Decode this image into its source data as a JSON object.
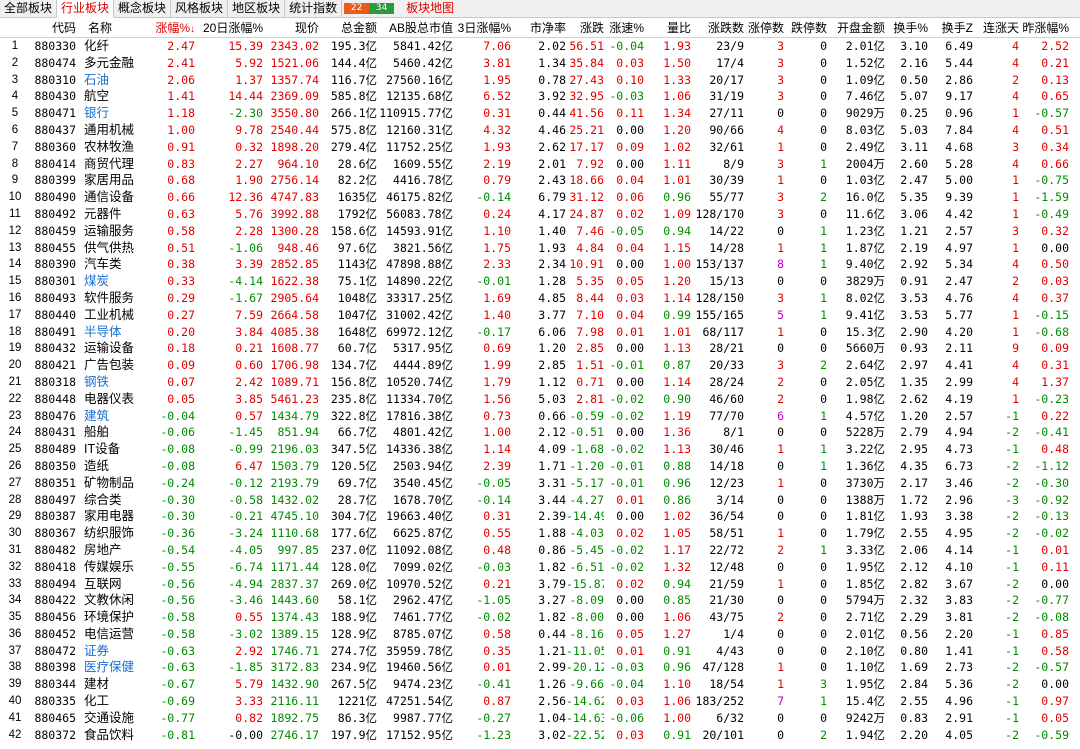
{
  "tabs": [
    "全部板块",
    "行业板块",
    "概念板块",
    "风格板块",
    "地区板块",
    "统计指数"
  ],
  "active_tab": 1,
  "breadth": {
    "up": "22",
    "down": "34"
  },
  "map_tab": "板块地图",
  "columns": [
    "",
    "代码",
    "名称",
    "涨幅%",
    "20日涨幅%",
    "现价",
    "总金额",
    "AB股总市值",
    "3日涨幅%",
    "市净率",
    "涨跌",
    "涨速%",
    "量比",
    "涨跌数",
    "涨停数",
    "跌停数",
    "开盘金额",
    "换手%",
    "换手Z",
    "连涨天",
    "昨涨幅%"
  ],
  "sort_column": "涨幅%",
  "sort_arrow": "↓",
  "colors": {
    "up": "#e00000",
    "down": "#008a00",
    "link": "#1a6fd0",
    "magenta": "#c000c0"
  },
  "rows": [
    [
      "1",
      "880330",
      "化纤",
      "2.47",
      "15.39",
      "2343.02",
      "195.3亿",
      "5841.42亿",
      "7.06",
      "2.02",
      "56.51",
      "-0.04",
      "1.93",
      "23/9",
      "3",
      "0",
      "2.01亿",
      "3.10",
      "6.49",
      "4",
      "2.52"
    ],
    [
      "2",
      "880474",
      "多元金融",
      "2.41",
      "5.92",
      "1521.06",
      "144.4亿",
      "5460.42亿",
      "3.81",
      "1.34",
      "35.84",
      "0.03",
      "1.50",
      "17/4",
      "3",
      "0",
      "1.52亿",
      "2.16",
      "5.44",
      "4",
      "0.21"
    ],
    [
      "3",
      "880310",
      "石油",
      "2.06",
      "1.37",
      "1357.74",
      "116.7亿",
      "27560.16亿",
      "1.95",
      "0.78",
      "27.43",
      "0.10",
      "1.33",
      "20/17",
      "3",
      "0",
      "1.09亿",
      "0.50",
      "2.86",
      "2",
      "0.13"
    ],
    [
      "4",
      "880430",
      "航空",
      "1.41",
      "14.44",
      "2369.09",
      "585.8亿",
      "12135.68亿",
      "6.52",
      "3.92",
      "32.95",
      "-0.03",
      "1.06",
      "31/19",
      "3",
      "0",
      "7.46亿",
      "5.07",
      "9.17",
      "4",
      "0.65"
    ],
    [
      "5",
      "880471",
      "银行",
      "1.18",
      "-2.30",
      "3550.80",
      "266.1亿",
      "110915.77亿",
      "0.31",
      "0.44",
      "41.56",
      "0.11",
      "1.34",
      "27/11",
      "0",
      "0",
      "9029万",
      "0.25",
      "0.96",
      "1",
      "-0.57"
    ],
    [
      "6",
      "880437",
      "通用机械",
      "1.00",
      "9.78",
      "2540.44",
      "575.8亿",
      "12160.31亿",
      "4.32",
      "4.46",
      "25.21",
      "0.00",
      "1.20",
      "90/66",
      "4",
      "0",
      "8.03亿",
      "5.03",
      "7.84",
      "4",
      "0.51"
    ],
    [
      "7",
      "880360",
      "农林牧渔",
      "0.91",
      "0.32",
      "1898.20",
      "279.4亿",
      "11752.25亿",
      "1.93",
      "2.62",
      "17.17",
      "0.09",
      "1.02",
      "32/61",
      "1",
      "0",
      "2.49亿",
      "3.11",
      "4.68",
      "3",
      "0.34"
    ],
    [
      "8",
      "880414",
      "商贸代理",
      "0.83",
      "2.27",
      "964.10",
      "28.6亿",
      "1609.55亿",
      "2.19",
      "2.01",
      "7.92",
      "0.00",
      "1.11",
      "8/9",
      "3",
      "1",
      "2004万",
      "2.60",
      "5.28",
      "4",
      "0.66"
    ],
    [
      "9",
      "880399",
      "家居用品",
      "0.68",
      "1.90",
      "2756.14",
      "82.2亿",
      "4416.78亿",
      "0.79",
      "2.43",
      "18.66",
      "0.04",
      "1.01",
      "30/39",
      "1",
      "0",
      "1.03亿",
      "2.47",
      "5.00",
      "1",
      "-0.75"
    ],
    [
      "10",
      "880490",
      "通信设备",
      "0.66",
      "12.36",
      "4747.83",
      "1635亿",
      "46175.82亿",
      "-0.14",
      "6.79",
      "31.12",
      "0.06",
      "0.96",
      "55/77",
      "3",
      "2",
      "16.0亿",
      "5.35",
      "9.39",
      "1",
      "-1.59"
    ],
    [
      "11",
      "880492",
      "元器件",
      "0.63",
      "5.76",
      "3992.88",
      "1792亿",
      "56083.78亿",
      "0.24",
      "4.17",
      "24.87",
      "0.02",
      "1.09",
      "128/170",
      "3",
      "0",
      "11.6亿",
      "3.06",
      "4.42",
      "1",
      "-0.49"
    ],
    [
      "12",
      "880459",
      "运输服务",
      "0.58",
      "2.28",
      "1300.28",
      "158.6亿",
      "14593.91亿",
      "1.10",
      "1.40",
      "7.46",
      "-0.05",
      "0.94",
      "14/22",
      "0",
      "1",
      "1.23亿",
      "1.21",
      "2.57",
      "3",
      "0.32"
    ],
    [
      "13",
      "880455",
      "供气供热",
      "0.51",
      "-1.06",
      "948.46",
      "97.6亿",
      "3821.56亿",
      "1.75",
      "1.93",
      "4.84",
      "0.04",
      "1.15",
      "14/28",
      "1",
      "1",
      "1.87亿",
      "2.19",
      "4.97",
      "1",
      "0.00"
    ],
    [
      "14",
      "880390",
      "汽车类",
      "0.38",
      "3.39",
      "2852.85",
      "1143亿",
      "47898.88亿",
      "2.33",
      "2.34",
      "10.91",
      "0.00",
      "1.00",
      "153/137",
      "8",
      "1",
      "9.40亿",
      "2.92",
      "5.34",
      "4",
      "0.50"
    ],
    [
      "15",
      "880301",
      "煤炭",
      "0.33",
      "-4.14",
      "1622.38",
      "75.1亿",
      "14890.22亿",
      "-0.01",
      "1.28",
      "5.35",
      "0.05",
      "1.20",
      "15/13",
      "0",
      "0",
      "3829万",
      "0.91",
      "2.47",
      "2",
      "0.03"
    ],
    [
      "16",
      "880493",
      "软件服务",
      "0.29",
      "-1.67",
      "2905.64",
      "1048亿",
      "33317.25亿",
      "1.69",
      "4.85",
      "8.44",
      "0.03",
      "1.14",
      "128/150",
      "3",
      "1",
      "8.02亿",
      "3.53",
      "4.76",
      "4",
      "0.37"
    ],
    [
      "17",
      "880440",
      "工业机械",
      "0.27",
      "7.59",
      "2664.58",
      "1047亿",
      "31002.42亿",
      "1.40",
      "3.77",
      "7.10",
      "0.04",
      "0.99",
      "155/165",
      "5",
      "1",
      "9.41亿",
      "3.53",
      "5.77",
      "1",
      "-0.15"
    ],
    [
      "18",
      "880491",
      "半导体",
      "0.20",
      "3.84",
      "4085.38",
      "1648亿",
      "69972.12亿",
      "-0.17",
      "6.06",
      "7.98",
      "0.01",
      "1.01",
      "68/117",
      "1",
      "0",
      "15.3亿",
      "2.90",
      "4.20",
      "1",
      "-0.68"
    ],
    [
      "19",
      "880432",
      "运输设备",
      "0.18",
      "0.21",
      "1608.77",
      "60.7亿",
      "5317.95亿",
      "0.69",
      "1.20",
      "2.85",
      "0.00",
      "1.13",
      "28/21",
      "0",
      "0",
      "5660万",
      "0.93",
      "2.11",
      "9",
      "0.09"
    ],
    [
      "20",
      "880421",
      "广告包装",
      "0.09",
      "0.60",
      "1706.98",
      "134.7亿",
      "4444.89亿",
      "1.99",
      "2.85",
      "1.51",
      "-0.01",
      "0.87",
      "20/33",
      "3",
      "2",
      "2.64亿",
      "2.97",
      "4.41",
      "4",
      "0.31"
    ],
    [
      "21",
      "880318",
      "钢铁",
      "0.07",
      "2.42",
      "1089.71",
      "156.8亿",
      "10520.74亿",
      "1.79",
      "1.12",
      "0.71",
      "0.00",
      "1.14",
      "28/24",
      "2",
      "0",
      "2.05亿",
      "1.35",
      "2.99",
      "4",
      "1.37"
    ],
    [
      "22",
      "880448",
      "电器仪表",
      "0.05",
      "3.85",
      "5461.23",
      "235.8亿",
      "11334.70亿",
      "1.56",
      "5.03",
      "2.81",
      "-0.02",
      "0.90",
      "46/60",
      "2",
      "0",
      "1.98亿",
      "2.62",
      "4.19",
      "1",
      "-0.23"
    ],
    [
      "23",
      "880476",
      "建筑",
      "-0.04",
      "0.57",
      "1434.79",
      "322.8亿",
      "17816.38亿",
      "0.73",
      "0.66",
      "-0.59",
      "-0.02",
      "1.19",
      "77/70",
      "6",
      "1",
      "4.57亿",
      "1.20",
      "2.57",
      "-1",
      "0.22"
    ],
    [
      "24",
      "880431",
      "船舶",
      "-0.06",
      "-1.45",
      "851.94",
      "66.7亿",
      "4801.42亿",
      "1.00",
      "2.12",
      "-0.51",
      "0.00",
      "1.36",
      "8/1",
      "0",
      "0",
      "5228万",
      "2.79",
      "4.94",
      "-2",
      "-0.41"
    ],
    [
      "25",
      "880489",
      "IT设备",
      "-0.08",
      "-0.99",
      "2196.03",
      "347.5亿",
      "14336.38亿",
      "1.14",
      "4.09",
      "-1.68",
      "-0.02",
      "1.13",
      "30/46",
      "1",
      "1",
      "3.22亿",
      "2.95",
      "4.73",
      "-1",
      "0.48"
    ],
    [
      "26",
      "880350",
      "造纸",
      "-0.08",
      "6.47",
      "1503.79",
      "120.5亿",
      "2503.94亿",
      "2.39",
      "1.71",
      "-1.20",
      "-0.01",
      "0.88",
      "14/18",
      "0",
      "1",
      "1.36亿",
      "4.35",
      "6.73",
      "-2",
      "-1.12"
    ],
    [
      "27",
      "880351",
      "矿物制品",
      "-0.24",
      "-0.12",
      "2193.79",
      "69.7亿",
      "3540.45亿",
      "-0.05",
      "3.31",
      "-5.17",
      "-0.01",
      "0.96",
      "12/23",
      "1",
      "0",
      "3730万",
      "2.17",
      "3.46",
      "-2",
      "-0.30"
    ],
    [
      "28",
      "880497",
      "综合类",
      "-0.30",
      "-0.58",
      "1432.02",
      "28.7亿",
      "1678.70亿",
      "-0.14",
      "3.44",
      "-4.27",
      "0.01",
      "0.86",
      "3/14",
      "0",
      "0",
      "1388万",
      "1.72",
      "2.96",
      "-3",
      "-0.92"
    ],
    [
      "29",
      "880387",
      "家用电器",
      "-0.30",
      "-0.21",
      "4745.10",
      "304.7亿",
      "19663.40亿",
      "0.31",
      "2.39",
      "-14.49",
      "0.00",
      "1.02",
      "36/54",
      "0",
      "0",
      "1.81亿",
      "1.93",
      "3.38",
      "-2",
      "-0.13"
    ],
    [
      "30",
      "880367",
      "纺织服饰",
      "-0.36",
      "-3.24",
      "1110.68",
      "177.6亿",
      "6625.87亿",
      "0.55",
      "1.88",
      "-4.03",
      "0.02",
      "1.05",
      "58/51",
      "1",
      "0",
      "1.79亿",
      "2.55",
      "4.95",
      "-2",
      "-0.02"
    ],
    [
      "31",
      "880482",
      "房地产",
      "-0.54",
      "-4.05",
      "997.85",
      "237.0亿",
      "11092.08亿",
      "0.48",
      "0.86",
      "-5.45",
      "-0.02",
      "1.17",
      "22/72",
      "2",
      "1",
      "3.33亿",
      "2.06",
      "4.14",
      "-1",
      "0.01"
    ],
    [
      "32",
      "880418",
      "传媒娱乐",
      "-0.55",
      "-6.74",
      "1171.44",
      "128.0亿",
      "7099.02亿",
      "-0.03",
      "1.82",
      "-6.51",
      "-0.02",
      "1.32",
      "12/48",
      "0",
      "0",
      "1.95亿",
      "2.12",
      "4.10",
      "-1",
      "0.11"
    ],
    [
      "33",
      "880494",
      "互联网",
      "-0.56",
      "-4.94",
      "2837.37",
      "269.0亿",
      "10970.52亿",
      "0.21",
      "3.79",
      "-15.87",
      "0.02",
      "0.94",
      "21/59",
      "1",
      "0",
      "1.85亿",
      "2.82",
      "3.67",
      "-2",
      "0.00"
    ],
    [
      "34",
      "880422",
      "文教休闲",
      "-0.56",
      "-3.46",
      "1443.60",
      "58.1亿",
      "2962.47亿",
      "-1.05",
      "3.27",
      "-8.09",
      "0.00",
      "0.85",
      "21/30",
      "0",
      "0",
      "5794万",
      "2.32",
      "3.83",
      "-2",
      "-0.77"
    ],
    [
      "35",
      "880456",
      "环境保护",
      "-0.58",
      "0.55",
      "1374.43",
      "188.9亿",
      "7461.77亿",
      "-0.02",
      "1.82",
      "-8.00",
      "0.00",
      "1.06",
      "43/75",
      "2",
      "0",
      "2.71亿",
      "2.29",
      "3.81",
      "-2",
      "-0.08"
    ],
    [
      "36",
      "880452",
      "电信运营",
      "-0.58",
      "-3.02",
      "1389.15",
      "128.9亿",
      "8785.07亿",
      "0.58",
      "0.44",
      "-8.16",
      "0.05",
      "1.27",
      "1/4",
      "0",
      "0",
      "2.01亿",
      "0.56",
      "2.20",
      "-1",
      "0.85"
    ],
    [
      "37",
      "880472",
      "证券",
      "-0.63",
      "2.92",
      "1746.71",
      "274.7亿",
      "35959.78亿",
      "0.35",
      "1.21",
      "-11.05",
      "0.01",
      "0.91",
      "4/43",
      "0",
      "0",
      "2.10亿",
      "0.80",
      "1.41",
      "-1",
      "0.58"
    ],
    [
      "38",
      "880398",
      "医疗保健",
      "-0.63",
      "-1.85",
      "3172.83",
      "234.9亿",
      "19460.56亿",
      "0.01",
      "2.99",
      "-20.12",
      "-0.03",
      "0.96",
      "47/128",
      "1",
      "0",
      "1.10亿",
      "1.69",
      "2.73",
      "-2",
      "-0.57"
    ],
    [
      "39",
      "880344",
      "建材",
      "-0.67",
      "5.79",
      "1432.90",
      "267.5亿",
      "9474.23亿",
      "-0.41",
      "1.26",
      "-9.66",
      "-0.04",
      "1.10",
      "18/54",
      "1",
      "3",
      "1.95亿",
      "2.84",
      "5.36",
      "-2",
      "0.00"
    ],
    [
      "40",
      "880335",
      "化工",
      "-0.69",
      "3.33",
      "2116.11",
      "1221亿",
      "47251.54亿",
      "0.87",
      "2.56",
      "-14.62",
      "0.03",
      "1.06",
      "183/252",
      "7",
      "1",
      "15.4亿",
      "2.55",
      "4.96",
      "-1",
      "0.97"
    ],
    [
      "41",
      "880465",
      "交通设施",
      "-0.77",
      "0.82",
      "1892.75",
      "86.3亿",
      "9987.77亿",
      "-0.27",
      "1.04",
      "-14.63",
      "-0.06",
      "1.00",
      "6/32",
      "0",
      "0",
      "9242万",
      "0.83",
      "2.91",
      "-1",
      "0.05"
    ],
    [
      "42",
      "880372",
      "食品饮料",
      "-0.81",
      "-0.00",
      "2746.17",
      "197.9亿",
      "17152.95亿",
      "-1.23",
      "3.02",
      "-22.52",
      "0.03",
      "0.91",
      "20/101",
      "0",
      "2",
      "1.94亿",
      "2.20",
      "4.05",
      "-2",
      "-0.59"
    ]
  ]
}
